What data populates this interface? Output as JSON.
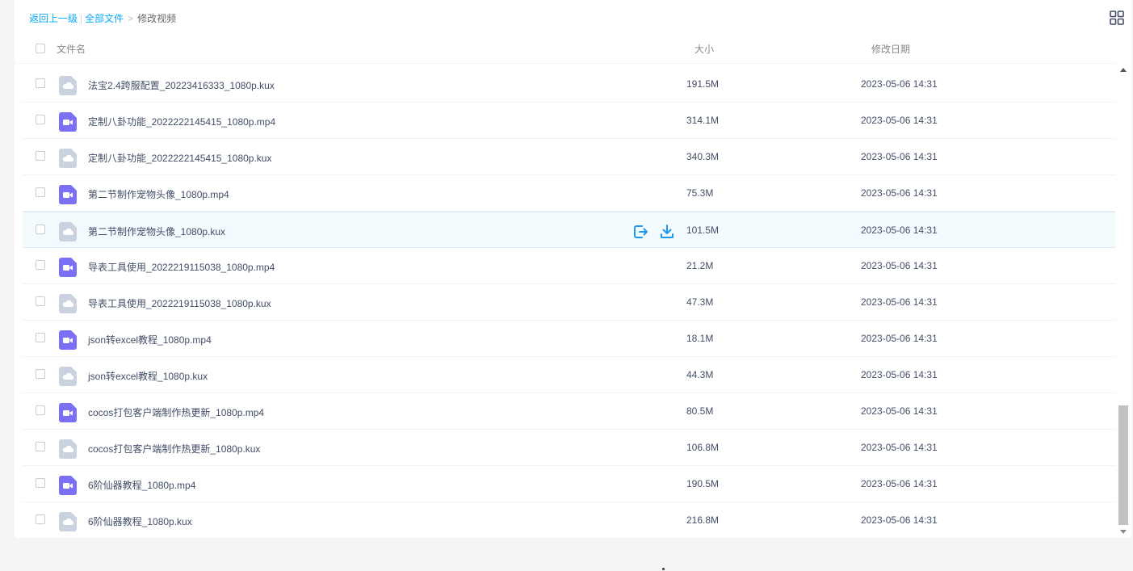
{
  "breadcrumb": {
    "back": "返回上一级",
    "separator": "|",
    "all_files": "全部文件",
    "arrow": ">",
    "current": "修改视频"
  },
  "header": {
    "name": "文件名",
    "size": "大小",
    "date": "修改日期"
  },
  "colors": {
    "link": "#09aaff",
    "video_icon": "#7b6ff5",
    "kux_icon": "#c9d2de",
    "action_icon": "#1a9bf0"
  },
  "files": [
    {
      "name": "法宝2.4跨服配置_20223416333_1080p.kux",
      "size": "191.5M",
      "date": "2023-05-06 14:31",
      "type": "kux"
    },
    {
      "name": "定制八卦功能_2022222145415_1080p.mp4",
      "size": "314.1M",
      "date": "2023-05-06 14:31",
      "type": "mp4"
    },
    {
      "name": "定制八卦功能_2022222145415_1080p.kux",
      "size": "340.3M",
      "date": "2023-05-06 14:31",
      "type": "kux"
    },
    {
      "name": "第二节制作宠物头像_1080p.mp4",
      "size": "75.3M",
      "date": "2023-05-06 14:31",
      "type": "mp4"
    },
    {
      "name": "第二节制作宠物头像_1080p.kux",
      "size": "101.5M",
      "date": "2023-05-06 14:31",
      "type": "kux"
    },
    {
      "name": "导表工具使用_2022219115038_1080p.mp4",
      "size": "21.2M",
      "date": "2023-05-06 14:31",
      "type": "mp4"
    },
    {
      "name": "导表工具使用_2022219115038_1080p.kux",
      "size": "47.3M",
      "date": "2023-05-06 14:31",
      "type": "kux"
    },
    {
      "name": "json转excel教程_1080p.mp4",
      "size": "18.1M",
      "date": "2023-05-06 14:31",
      "type": "mp4"
    },
    {
      "name": "json转excel教程_1080p.kux",
      "size": "44.3M",
      "date": "2023-05-06 14:31",
      "type": "kux"
    },
    {
      "name": "cocos打包客户端制作热更新_1080p.mp4",
      "size": "80.5M",
      "date": "2023-05-06 14:31",
      "type": "mp4"
    },
    {
      "name": "cocos打包客户端制作热更新_1080p.kux",
      "size": "106.8M",
      "date": "2023-05-06 14:31",
      "type": "kux"
    },
    {
      "name": "6阶仙器教程_1080p.mp4",
      "size": "190.5M",
      "date": "2023-05-06 14:31",
      "type": "mp4"
    },
    {
      "name": "6阶仙器教程_1080p.kux",
      "size": "216.8M",
      "date": "2023-05-06 14:31",
      "type": "kux"
    }
  ],
  "hovered_row_index": 4,
  "hover_actions": [
    "share-icon",
    "download-icon"
  ]
}
